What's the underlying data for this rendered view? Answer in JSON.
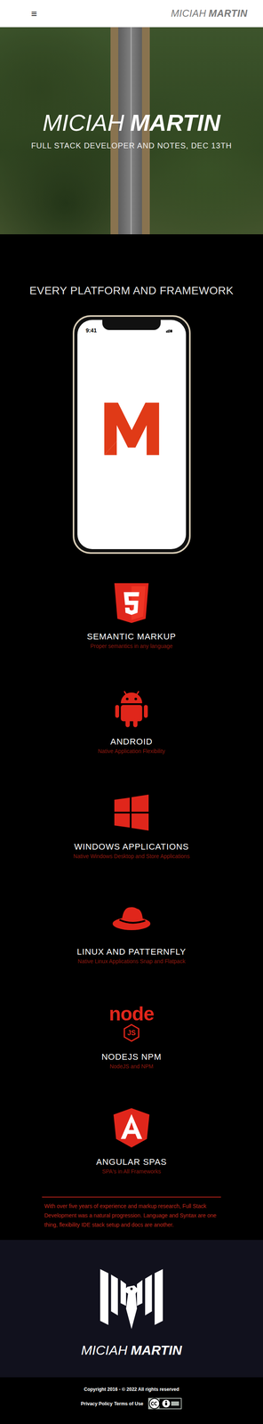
{
  "navbar": {
    "menu_icon": "≡",
    "logo": {
      "first": "MICIAH",
      "last": "MARTIN"
    }
  },
  "hero": {
    "title": {
      "first": "MICIAH",
      "last": "MARTIN"
    },
    "subtitle": "FULL STACK DEVELOPER AND NOTES, DEC 13TH"
  },
  "platforms": {
    "heading": "EVERY PLATFORM AND FRAMEWORK",
    "phone": {
      "time": "9:41"
    },
    "items": [
      {
        "kind": "html5",
        "title": "SEMANTIC MARKUP",
        "subtitle": "Proper semantics in any language"
      },
      {
        "kind": "android",
        "title": "ANDROID",
        "subtitle": "Native Application Flexibility"
      },
      {
        "kind": "windows",
        "title": "WINDOWS APPLICATIONS",
        "subtitle": "Native Windows Desktop and Store Applications"
      },
      {
        "kind": "redhat",
        "title": "LINUX AND PATTERNFLY",
        "subtitle": "Native Linux Applications Snap and Flatpack"
      },
      {
        "kind": "node",
        "icon_text": "node",
        "icon_badge": "JS",
        "title": "NODEJS NPM",
        "subtitle": "NodeJS and NPM"
      },
      {
        "kind": "angular",
        "title": "ANGULAR SPAS",
        "subtitle": "SPA's in All Frameworks"
      }
    ]
  },
  "about": "With over five years of experience and markup research, Full Stack Development was a natural progression. Language and Syntax are one thing, flexibility IDE stack setup and docs are another.",
  "footer": {
    "brand": {
      "first": "MICIAH",
      "last": "MARTIN"
    },
    "copyright": "Copyright 2016 - © 2022 All rights reserved",
    "links": [
      "Privacy Policy",
      "Terms of Use"
    ]
  }
}
